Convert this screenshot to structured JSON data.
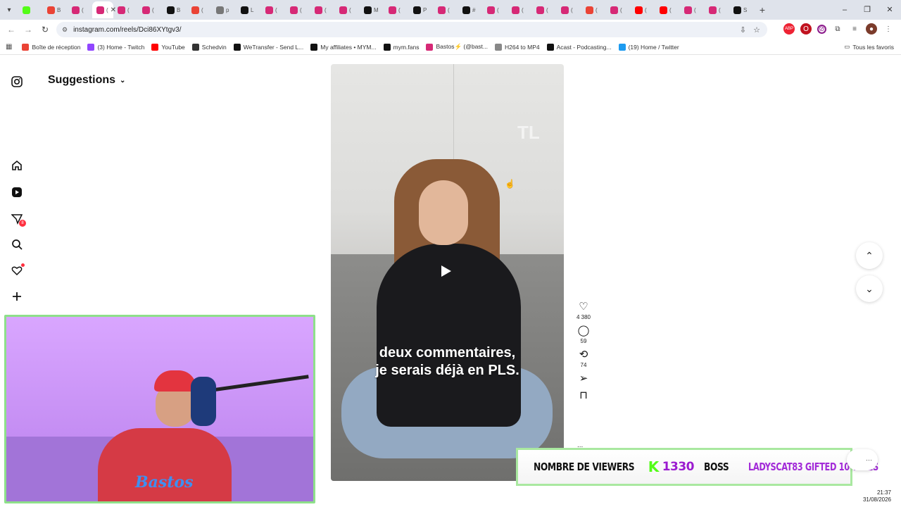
{
  "browser": {
    "tabs": [
      {
        "icon": "kick-icon",
        "color": "#53fc18",
        "letter": ""
      },
      {
        "icon": "gmail-icon",
        "color": "#ea4335",
        "letter": "B"
      },
      {
        "icon": "instagram-icon",
        "color": "#d62976",
        "letter": "("
      },
      {
        "icon": "instagram-icon",
        "color": "#d62976",
        "letter": "(",
        "active": true
      },
      {
        "icon": "instagram-icon",
        "color": "#d62976",
        "letter": "("
      },
      {
        "icon": "instagram-icon",
        "color": "#d62976",
        "letter": "("
      },
      {
        "icon": "tiktok-icon",
        "color": "#111111",
        "letter": "B"
      },
      {
        "icon": "gmail-icon",
        "color": "#ea4335",
        "letter": "("
      },
      {
        "icon": "globe-icon",
        "color": "#777777",
        "letter": "p"
      },
      {
        "icon": "wetransfer-icon",
        "color": "#111111",
        "letter": "L"
      },
      {
        "icon": "instagram-icon",
        "color": "#d62976",
        "letter": "("
      },
      {
        "icon": "instagram-icon",
        "color": "#d62976",
        "letter": "("
      },
      {
        "icon": "instagram-icon",
        "color": "#d62976",
        "letter": "("
      },
      {
        "icon": "instagram-icon",
        "color": "#d62976",
        "letter": "("
      },
      {
        "icon": "tiktok-icon",
        "color": "#111111",
        "letter": "M"
      },
      {
        "icon": "instagram-icon",
        "color": "#d62976",
        "letter": "("
      },
      {
        "icon": "tiktok-icon",
        "color": "#111111",
        "letter": "P"
      },
      {
        "icon": "instagram-icon",
        "color": "#d62976",
        "letter": "("
      },
      {
        "icon": "tiktok-icon",
        "color": "#111111",
        "letter": "#"
      },
      {
        "icon": "instagram-icon",
        "color": "#d62976",
        "letter": "("
      },
      {
        "icon": "instagram-icon",
        "color": "#d62976",
        "letter": "("
      },
      {
        "icon": "instagram-icon",
        "color": "#d62976",
        "letter": "("
      },
      {
        "icon": "instagram-icon",
        "color": "#d62976",
        "letter": "("
      },
      {
        "icon": "gmail-icon",
        "color": "#ea4335",
        "letter": "("
      },
      {
        "icon": "instagram-icon",
        "color": "#d62976",
        "letter": "("
      },
      {
        "icon": "youtube-icon",
        "color": "#ff0000",
        "letter": "("
      },
      {
        "icon": "youtube-icon",
        "color": "#ff0000",
        "letter": "("
      },
      {
        "icon": "instagram-icon",
        "color": "#d62976",
        "letter": "("
      },
      {
        "icon": "instagram-icon",
        "color": "#d62976",
        "letter": "("
      },
      {
        "icon": "tiktok-icon",
        "color": "#111111",
        "letter": "S"
      }
    ],
    "url": "instagram.com/reels/Dci86XYtgv3/",
    "bookmarks": [
      {
        "label": "Boîte de réception",
        "color": "#ea4335"
      },
      {
        "label": "(3) Home - Twitch",
        "color": "#9146ff"
      },
      {
        "label": "YouTube",
        "color": "#ff0000"
      },
      {
        "label": "Schedvin",
        "color": "#333333"
      },
      {
        "label": "WeTransfer - Send L...",
        "color": "#111111"
      },
      {
        "label": "My affiliates • MYM...",
        "color": "#111111"
      },
      {
        "label": "mym.fans",
        "color": "#111111"
      },
      {
        "label": "Bastos⚡ (@bast...",
        "color": "#d62976"
      },
      {
        "label": "H264 to MP4",
        "color": "#888888"
      },
      {
        "label": "Acast - Podcasting...",
        "color": "#111111"
      },
      {
        "label": "(19) Home / Twitter",
        "color": "#1d9bf0"
      }
    ],
    "all_bookmarks": "Tous les favoris"
  },
  "instagram": {
    "suggestions_label": "Suggestions",
    "notification_count": "8",
    "subtitle_line1": "deux commentaires,",
    "subtitle_line2": "je serais déjà en PLS.",
    "likes": "4 380",
    "comments": "59",
    "reposts": "74",
    "more": "..."
  },
  "overlay": {
    "viewers_label": "NOMBRE DE VIEWERS",
    "viewers_count": "1330",
    "boss_label": "BOSS",
    "gift_text": "LADYSCAT83 GIFTED 10 TIMES",
    "cam_logo": "Bastos"
  },
  "taskbar": {
    "time": "21:37",
    "date": "31/08/2026"
  }
}
